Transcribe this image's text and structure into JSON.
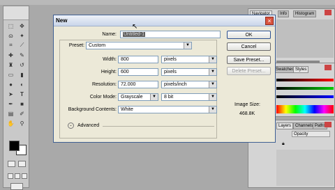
{
  "dialog": {
    "title": "New",
    "name_label": "Name:",
    "name_value": "Untitled-1",
    "preset_label": "Preset:",
    "preset_value": "Custom",
    "width_label": "Width:",
    "width_value": "800",
    "width_unit": "pixels",
    "height_label": "Height:",
    "height_value": "600",
    "height_unit": "pixels",
    "resolution_label": "Resolution:",
    "resolution_value": "72.000",
    "resolution_unit": "pixels/inch",
    "color_mode_label": "Color Mode:",
    "color_mode_value": "Grayscale",
    "bit_value": "8 bit",
    "background_label": "Background Contents:",
    "background_value": "White",
    "advanced_label": "Advanced",
    "ok_label": "OK",
    "cancel_label": "Cancel",
    "save_preset_label": "Save Preset...",
    "delete_preset_label": "Delete Preset...",
    "image_size_label": "Image Size:",
    "image_size_value": "468.8K"
  },
  "panels": {
    "top_tabs": [
      "Navigator",
      "Info",
      "Histogram"
    ],
    "middle_tabs": [
      "Swatches",
      "Styles"
    ],
    "bottom_tabs": [
      "Layers",
      "Channels",
      "Paths"
    ],
    "bottom_field": "Opacity"
  }
}
